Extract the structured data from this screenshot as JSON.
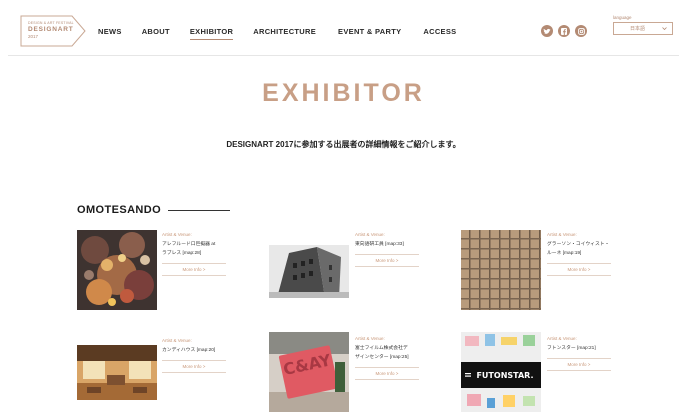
{
  "header": {
    "logo": {
      "small": "DESIGN & ART FESTIVAL",
      "main": "DESIGNART",
      "year": "2017"
    },
    "nav": [
      "NEWS",
      "ABOUT",
      "EXHIBITOR",
      "ARCHITECTURE",
      "EVENT & PARTY",
      "ACCESS"
    ],
    "active_nav": "EXHIBITOR",
    "social_icons": [
      "twitter-icon",
      "facebook-icon",
      "instagram-icon"
    ],
    "language": {
      "label": "language",
      "value": "日本語"
    }
  },
  "page": {
    "title": "EXHIBITOR",
    "intro": "DESIGNART 2017に参加する出展者の詳細情報をご紹介します。"
  },
  "section": {
    "title": "OMOTESANDO",
    "cards": [
      {
        "label": "Artist & Venue:",
        "title_lines": [
          "アレフルード口巨擬器 at",
          "ラブレス [map:28]"
        ],
        "more": "More Info >"
      },
      {
        "label": "Artist & Venue:",
        "title_lines": [
          "東向語研工員 [map:33]"
        ],
        "more": "More Info >"
      },
      {
        "label": "Artist & Venue:",
        "title_lines": [
          "グラーソン・コイウィスト・",
          "ルーネ [map:19]"
        ],
        "more": "More Info >"
      },
      {
        "label": "Artist & Venue:",
        "title_lines": [
          "カンディハウス [map:20]"
        ],
        "more": "More Info >"
      },
      {
        "label": "Artist & Venue:",
        "title_lines": [
          "富士フイルム株式会社デ",
          "ザインセンター [map:25]"
        ],
        "more": "More Info >"
      },
      {
        "label": "Artist & Venue:",
        "title_lines": [
          "フトンスター [map:21]"
        ],
        "more": "More Info >"
      }
    ]
  },
  "images": {
    "sign_text": "C&AY",
    "futonstar_text": "FUTONSTAR."
  },
  "colors": {
    "accent": "#c89f86",
    "text": "#222222"
  }
}
